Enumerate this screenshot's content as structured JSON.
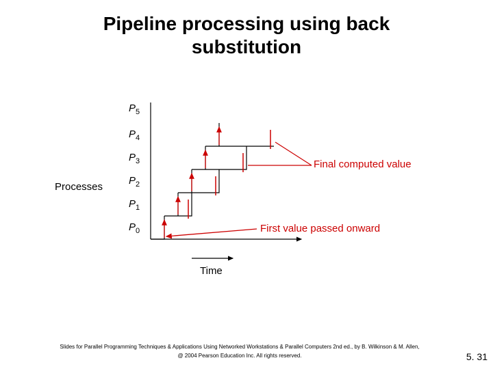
{
  "title_line1": "Pipeline processing using back",
  "title_line2": "substitution",
  "y_label": "Processes",
  "processes": [
    "P",
    "P",
    "P",
    "P",
    "P",
    "P"
  ],
  "process_subs": [
    "5",
    "4",
    "3",
    "2",
    "1",
    "0"
  ],
  "x_label": "Time",
  "annotation_final": "Final computed value",
  "annotation_first": "First value passed onward",
  "footer_line1": "Slides for Parallel Programming Techniques & Applications Using Networked Workstations & Parallel Computers 2nd ed., by B. Wilkinson & M. Allen,",
  "footer_line2": "@ 2004 Pearson Education Inc. All rights reserved.",
  "page_number": "5. 31",
  "chart_data": {
    "type": "bar",
    "title": "Pipeline processing using back substitution",
    "xlabel": "Time",
    "ylabel": "Processes",
    "categories": [
      "P0",
      "P1",
      "P2",
      "P3",
      "P4",
      "P5"
    ],
    "bars": [
      {
        "process": "P0",
        "start": 0,
        "end": 1
      },
      {
        "process": "P1",
        "start": 1,
        "end": 3
      },
      {
        "process": "P2",
        "start": 2,
        "end": 5
      },
      {
        "process": "P3",
        "start": 3,
        "end": 7
      },
      {
        "process": "P4",
        "start": 4,
        "end": 9
      },
      {
        "process": "P5",
        "start": 5,
        "end": 11
      }
    ],
    "annotations": [
      {
        "text": "First value passed onward",
        "target": "P0 end"
      },
      {
        "text": "Final computed value",
        "target": "each process bar end (red tick)"
      }
    ]
  }
}
